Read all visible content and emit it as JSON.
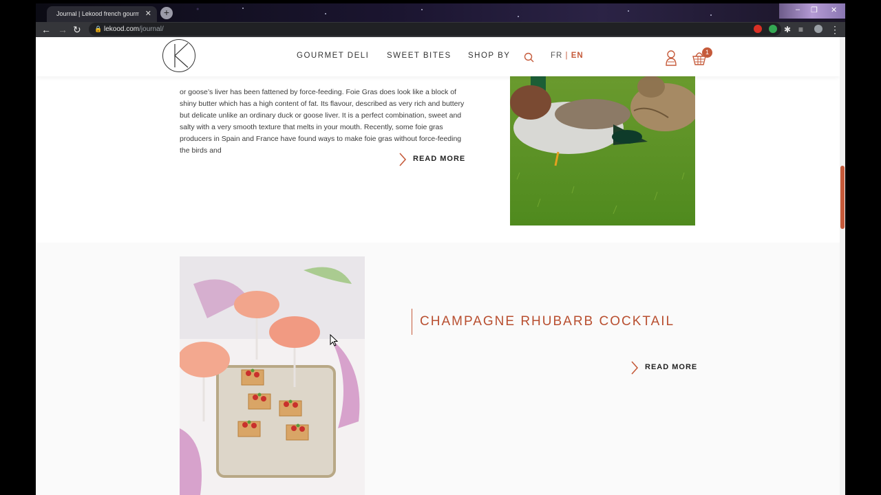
{
  "browser": {
    "tab_title": "Journal | Lekood french gourmet",
    "tab_close": "✕",
    "new_tab": "+",
    "url_domain": "lekood.com",
    "url_path": "/journal/",
    "window_controls": [
      "–",
      "❐",
      "✕"
    ]
  },
  "header": {
    "menu": [
      "GOURMET DELI",
      "SWEET BITES",
      "SHOP BY"
    ],
    "lang_fr": "FR",
    "lang_sep": "|",
    "lang_en": "EN",
    "cart_count": "1"
  },
  "posts": [
    {
      "excerpt": "or goose’s liver has been fattened by force-feeding. Foie Gras does look like a block of shiny butter which has a high content of fat. Its flavour, described as very  rich and buttery but delicate unlike an ordinary duck or goose liver. It is a perfect combination, sweet and salty with a very smooth texture that melts in your mouth. Recently, some foie gras producers in Spain and France have found ways to make foie gras without force-feeding the birds and",
      "read_more": "READ MORE"
    },
    {
      "title": "CHAMPAGNE RHUBARB COCKTAIL",
      "read_more": "READ MORE"
    }
  ],
  "colors": {
    "accent": "#c55a3a",
    "chrome_dark": "#35363a",
    "section_bg": "#fafafa"
  }
}
